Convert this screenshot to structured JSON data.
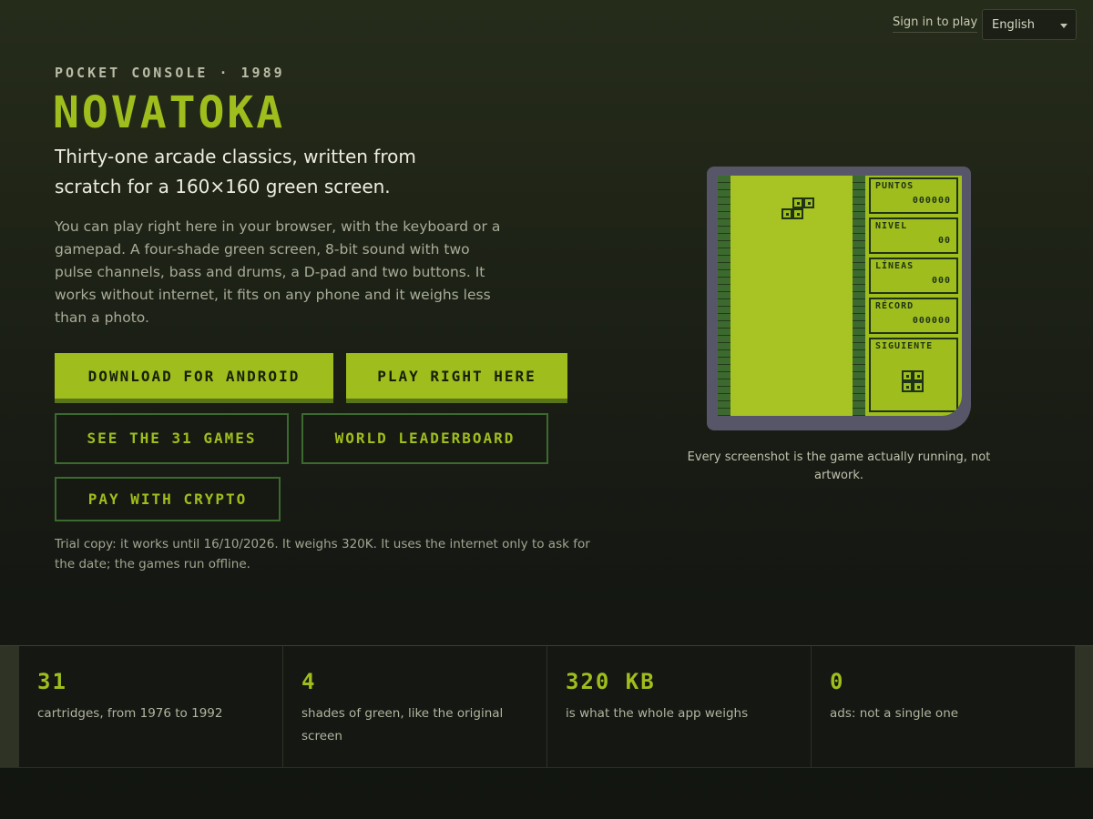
{
  "header": {
    "sign_in": "Sign in to play",
    "language": "English"
  },
  "hero": {
    "eyebrow": "POCKET CONSOLE · 1989",
    "title": "NOVATOKA",
    "lead": "Thirty-one arcade classics, written from scratch for a 160×160 green screen.",
    "body": "You can play right here in your browser, with the keyboard or a gamepad. A four-shade green screen, 8-bit sound with two pulse channels, bass and drums, a D-pad and two buttons. It works without internet, it fits on any phone and it weighs less than a photo.",
    "buttons": {
      "download": "DOWNLOAD FOR ANDROID",
      "play": "PLAY RIGHT HERE",
      "games": "SEE THE 31 GAMES",
      "leaderboard": "WORLD LEADERBOARD",
      "crypto": "PAY WITH CRYPTO"
    },
    "trial": "Trial copy: it works until 16/10/2026. It weighs 320K. It uses the internet only to ask for the date; the games run offline."
  },
  "game_screen": {
    "panels": [
      {
        "label": "PUNTOS",
        "value": "000000"
      },
      {
        "label": "NIVEL",
        "value": "00"
      },
      {
        "label": "LÍNEAS",
        "value": "000"
      },
      {
        "label": "RÉCORD",
        "value": "000000"
      },
      {
        "label": "SIGUIENTE",
        "value": ""
      }
    ],
    "caption": "Every screenshot is the game actually running, not artwork."
  },
  "stats": [
    {
      "number": "31",
      "label": "cartridges, from 1976 to 1992"
    },
    {
      "number": "4",
      "label": "shades of green, like the original screen"
    },
    {
      "number": "320 KB",
      "label": "is what the whole app weighs"
    },
    {
      "number": "0",
      "label": "ads: not a single one"
    }
  ],
  "colors": {
    "accent": "#9fbd1d",
    "dark_green": "#3c6a2e",
    "background": "#141712"
  }
}
